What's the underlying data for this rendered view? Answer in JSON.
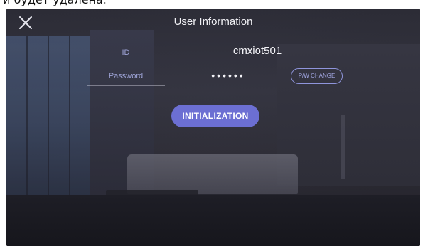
{
  "top_strip_text": "и будет удалена.",
  "header": {
    "title": "User Information",
    "close_icon": "close-icon"
  },
  "form": {
    "id_label": "ID",
    "id_value": "cmxiot501",
    "password_label": "Password",
    "password_value": "••••••",
    "pw_change_label": "P/W CHANGE"
  },
  "actions": {
    "initialization_label": "INITIALIZATION"
  },
  "colors": {
    "accent": "#6c6fd3",
    "label": "#9ea3d6",
    "text": "#f4f4f8"
  }
}
